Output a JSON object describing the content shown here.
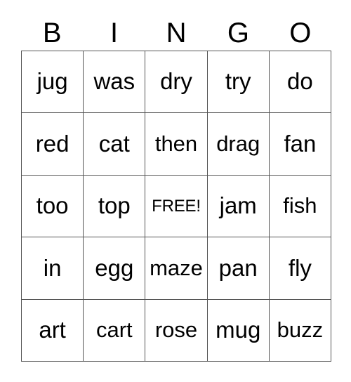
{
  "card": {
    "title_letters": [
      "B",
      "I",
      "N",
      "G",
      "O"
    ],
    "rows": [
      [
        "jug",
        "was",
        "dry",
        "try",
        "do"
      ],
      [
        "red",
        "cat",
        "then",
        "drag",
        "fan"
      ],
      [
        "too",
        "top",
        "FREE!",
        "jam",
        "fish"
      ],
      [
        "in",
        "egg",
        "maze",
        "pan",
        "fly"
      ],
      [
        "art",
        "cart",
        "rose",
        "mug",
        "buzz"
      ]
    ],
    "free_space": {
      "label": "FREE!",
      "row_index": 2,
      "column_index": 2
    },
    "colors": {
      "background": "#ffffff",
      "text": "#000000",
      "grid_line": "#555555"
    }
  }
}
